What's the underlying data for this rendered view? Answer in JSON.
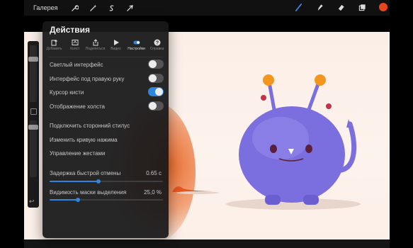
{
  "topbar": {
    "gallery_label": "Галерея",
    "left_tools": [
      "wrench-icon",
      "magic-wand-icon",
      "selection-icon",
      "transform-arrow-icon"
    ],
    "right_tools": [
      "brush-icon",
      "smudge-icon",
      "eraser-icon",
      "layers-icon"
    ],
    "current_color": "#e8451e"
  },
  "panel": {
    "title": "Действия",
    "tabs": [
      {
        "label": "Добавить",
        "icon": "add-icon",
        "active": false
      },
      {
        "label": "Холст",
        "icon": "canvas-icon",
        "active": false
      },
      {
        "label": "Поделиться",
        "icon": "share-icon",
        "active": false
      },
      {
        "label": "Видео",
        "icon": "video-play-icon",
        "active": false
      },
      {
        "label": "Настройки",
        "icon": "settings-toggle-icon",
        "active": true
      },
      {
        "label": "Справка",
        "icon": "help-icon",
        "active": false
      }
    ],
    "toggles": [
      {
        "label": "Светлый интерфейс",
        "on": false
      },
      {
        "label": "Интерфейс под правую руку",
        "on": false
      },
      {
        "label": "Курсор кисти",
        "on": true
      },
      {
        "label": "Отображение холста",
        "on": false
      }
    ],
    "links": [
      {
        "label": "Подключить сторонний стилус"
      },
      {
        "label": "Изменить кривую нажима"
      },
      {
        "label": "Управление жестами"
      }
    ],
    "sliders": [
      {
        "label": "Задержка быстрой отмены",
        "value": "0.65 с",
        "fraction": 0.43
      },
      {
        "label": "Видимость маски выделения",
        "value": "25,0 %",
        "fraction": 0.25
      }
    ]
  },
  "colors": {
    "accent": "#2e86de",
    "canvas_bg": "#fbeee6",
    "monster": "#7b6fe0",
    "antenna_ball": "#f3961e"
  }
}
